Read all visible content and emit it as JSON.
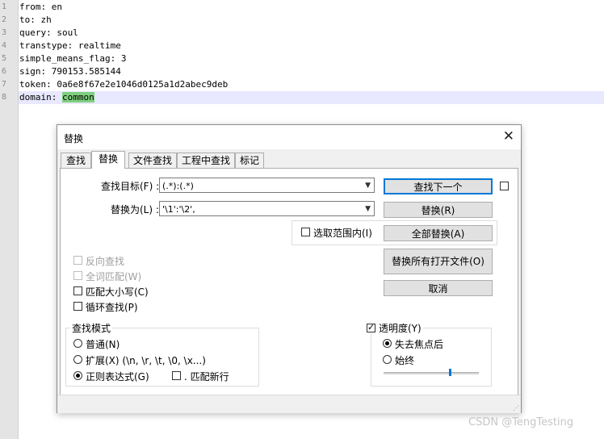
{
  "editor": {
    "lines": [
      {
        "no": "1",
        "text": "from: en"
      },
      {
        "no": "2",
        "text": "to: zh"
      },
      {
        "no": "3",
        "text": "query: soul"
      },
      {
        "no": "4",
        "text": "transtype: realtime"
      },
      {
        "no": "5",
        "text": "simple_means_flag: 3"
      },
      {
        "no": "6",
        "text": "sign: 790153.585144"
      },
      {
        "no": "7",
        "text": "token: 0a6e8f67e2e1046d0125a1d2abec9deb"
      },
      {
        "no": "8",
        "text": "domain: ",
        "highlight": "common"
      }
    ]
  },
  "dialog": {
    "title": "替换",
    "tabs": [
      "查找",
      "替换",
      "文件查找",
      "工程中查找",
      "标记"
    ],
    "find_label": "查找目标(F) :",
    "find_value": "(.*):(.*)",
    "replace_label": "替换为(L) :",
    "replace_value": "'\\1':'\\2',",
    "in_selection": "选取范围内(I)",
    "buttons": {
      "find_next": "查找下一个",
      "replace": "替换(R)",
      "replace_all": "全部替换(A)",
      "replace_all_open": "替换所有打开文件(O)",
      "cancel": "取消"
    },
    "options": {
      "backward": "反向查找",
      "whole_word": "全词匹配(W)",
      "match_case": "匹配大小写(C)",
      "wrap": "循环查找(P)"
    },
    "search_mode": {
      "title": "查找模式",
      "normal": "普通(N)",
      "extended": "扩展(X) (\\n, \\r, \\t, \\0, \\x...)",
      "regex": "正则表达式(G)",
      "dot_newline": ". 匹配新行"
    },
    "transparency": {
      "title": "透明度(Y)",
      "on_lose_focus": "失去焦点后",
      "always": "始终",
      "level": 0.7
    }
  },
  "watermark": "CSDN @TengTesting"
}
